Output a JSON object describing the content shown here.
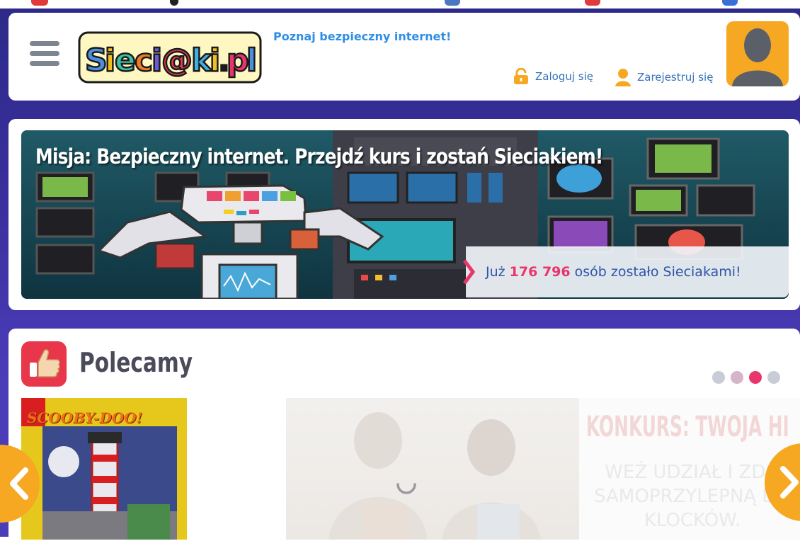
{
  "header": {
    "logo_alt": "Sieci@ki.pl",
    "tagline": "Poznaj bezpieczny internet!",
    "login_label": "Zaloguj się",
    "register_label": "Zarejestruj się"
  },
  "banner": {
    "title": "Misja: Bezpieczny internet. Przejdź kurs i zostań Sieciakiem!",
    "counter_prefix": "Już",
    "counter_number": "176 796",
    "counter_suffix": "osób zostało Sieciakami!"
  },
  "recommended": {
    "title": "Polecamy",
    "dots": [
      {
        "color": "#c8ccd6",
        "active": false
      },
      {
        "color": "#d6b5c8",
        "active": false
      },
      {
        "color": "#e8366c",
        "active": true
      },
      {
        "color": "#c8ccd6",
        "active": false
      }
    ],
    "slide1_text": "SCOOBY-DOO!",
    "slide3_headline": "KONKURS: TWOJA HI",
    "slide3_body": "WEŹ UDZIAŁ I ZDO SAMOPRZYLEPNĄ DO KLOCKÓW."
  },
  "icons": {
    "menu": "hamburger-menu-icon",
    "login": "padlock-icon",
    "register": "user-icon",
    "avatar": "user-silhouette-icon",
    "thumbs_up": "thumbs-up-icon",
    "prev": "chevron-left-icon",
    "next": "chevron-right-icon",
    "loading": "loading-spinner-icon"
  },
  "colors": {
    "accent_orange": "#f7a823",
    "accent_pink": "#e8366c",
    "link_blue": "#3473b8",
    "tagline_blue": "#2f8ee6",
    "background_purple": "#3a2f9c"
  }
}
